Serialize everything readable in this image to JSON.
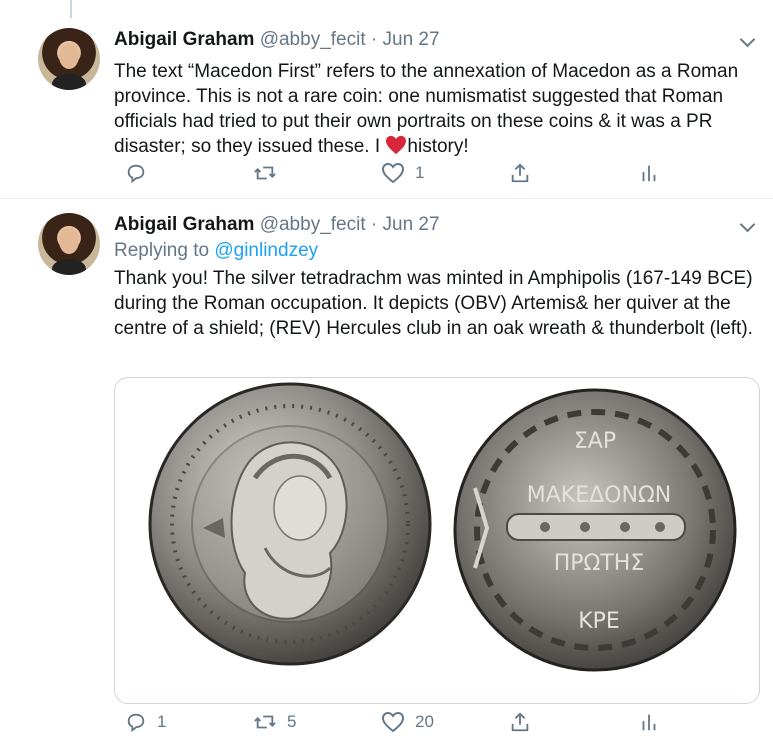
{
  "tweets": [
    {
      "author_name": "Abigail Graham",
      "author_handle": "@abby_fecit",
      "separator": "·",
      "date": "Jun 27",
      "text_before_heart": "The text “Macedon First” refers to the annexation of Macedon as a Roman province. This is not a rare coin: one numismatist suggested that Roman officials had tried to put their own portraits on these coins & it was a PR disaster; so they issued these. I ",
      "text_after_heart": "history!",
      "replies": "",
      "retweets": "",
      "likes": "1"
    },
    {
      "author_name": "Abigail Graham",
      "author_handle": "@abby_fecit",
      "separator": "·",
      "date": "Jun 27",
      "replying_label": "Replying to",
      "replying_to": "@ginlindzey",
      "text": "Thank you! The silver tetradrachm was minted in Amphipolis (167-149 BCE) during the Roman occupation. It depicts (OBV) Artemis& her quiver at the centre of a shield; (REV) Hercules club in an oak wreath & thunderbolt (left).",
      "coin_inscription_top": "ΣΑΡ",
      "coin_inscription_1": "ΜΑΚΕΔΟΝΩΝ",
      "coin_inscription_2": "ΠΡΩΤΗΣ",
      "coin_inscription_bottom": "ΚΡΕ",
      "replies": "1",
      "retweets": "5",
      "likes": "20"
    }
  ],
  "icons": [
    "reply-icon",
    "retweet-icon",
    "like-icon",
    "share-icon",
    "analytics-icon",
    "chevron-down-icon",
    "red-heart-emoji"
  ],
  "colors": {
    "text": "#14171a",
    "secondary": "#657786",
    "link": "#1da1f2",
    "border": "#e6ecf0",
    "heart": "#e0245e"
  }
}
